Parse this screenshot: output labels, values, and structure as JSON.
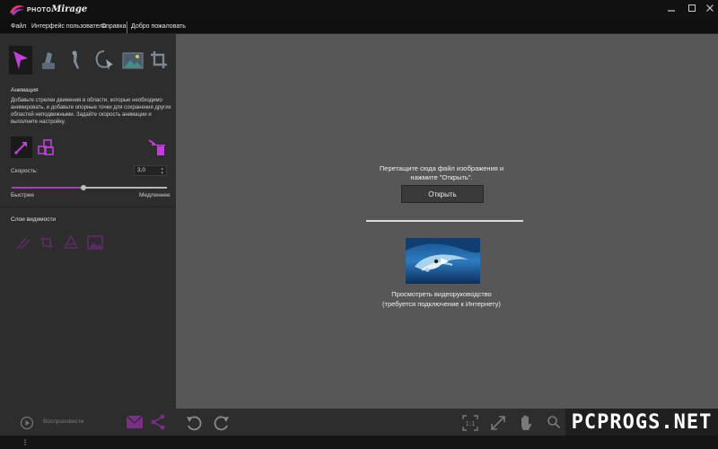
{
  "app": {
    "brand_prefix": "PHOTO",
    "brand_name": "Mirage",
    "accent_color": "#b038c4"
  },
  "menu": {
    "items": [
      "Файл",
      "Интерфейс пользователя",
      "Справка",
      "Добро пожаловать"
    ]
  },
  "tools": [
    "animation-arrow-icon",
    "mask-brush-icon",
    "anchor-point-icon",
    "selection-lasso-icon",
    "preview-image-icon",
    "crop-icon"
  ],
  "animation": {
    "title": "Анимация",
    "description": "Добавьте стрелки движения в области, которые необходимо анимировать, и добавьте опорные точки для сохранения других областей неподвижными. Задайте скорость анимации и выполните настройку.",
    "speed_label": "Скорость:",
    "speed_value": "3,0",
    "speed_slider_fraction": 0.46,
    "faster_label": "Быстрее",
    "slower_label": "Медленнее"
  },
  "layers": {
    "title": "Слои видимости"
  },
  "canvas": {
    "drop_line1": "Перетащите сюда файл изображения и",
    "drop_line2": "нажмите \"Открыть\".",
    "open_button": "Открыть",
    "tutorial_line1": "Просмотреть видеоруководство",
    "tutorial_line2": "(требуется подключение к Интернету)"
  },
  "bottom": {
    "play_label": "Воспроизвести"
  },
  "watermark": "PCPROGS.NET"
}
